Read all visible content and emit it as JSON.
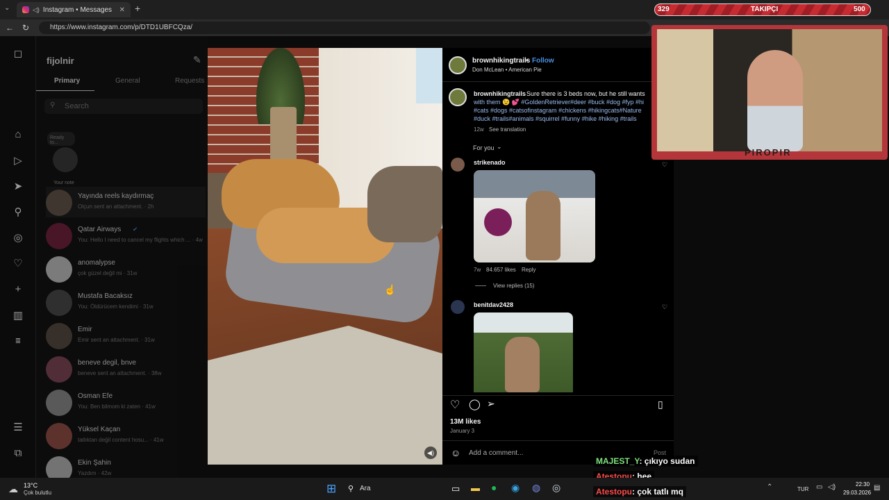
{
  "browser": {
    "tab_title": "Instagram • Messages",
    "url": "https://www.instagram.com/p/DTD1UBFCQza/"
  },
  "follower_bar": {
    "count_left": "329",
    "label": "TAKIPÇI",
    "count_right": "500"
  },
  "messages": {
    "username": "fijolnir",
    "tabs": [
      "Primary",
      "General",
      "Requests"
    ],
    "search_placeholder": "Search",
    "note_bubble": "Ready to...",
    "your_note": "Your note",
    "threads": [
      {
        "name": "Yayında reels kaydırmaç",
        "preview": "Olçun sent an attachment. · 2h"
      },
      {
        "name": "Qatar Airways",
        "preview": "You: Hello I need to cancel my flights which ... · 4w"
      },
      {
        "name": "anomalypse",
        "preview": "çok güzel değil mi · 31w"
      },
      {
        "name": "Mustafa Bacaksız",
        "preview": "You: Öldürücem kendimi · 31w"
      },
      {
        "name": "Emir",
        "preview": "Emir sent an attachment. · 31w"
      },
      {
        "name": "beneve degil, bnve",
        "preview": "beneve sent an attachment. · 38w"
      },
      {
        "name": "Osman Efe",
        "preview": "You: Ben bilmom ki zaten · 41w"
      },
      {
        "name": "Yüksel Kaçan",
        "preview": "tatlıktan değil content hosu... · 41w"
      },
      {
        "name": "Ekin Şahin",
        "preview": "Yazdım · 42w"
      }
    ]
  },
  "post": {
    "author": "brownhikingtrails",
    "follow": "Follow",
    "music": "Don McLean • American Pie",
    "caption_author": "brownhikingtrails",
    "caption_text": "Sure there is 3 beds now, but he still wants",
    "caption_line2": "with them 😉 💕 #GoldenRetriever#deer #buck #dog #fyp #hi",
    "caption_line3": "#cats #dogs #catsofinstagram #chickens #hikingcats#Nature",
    "caption_line4": "#duck #trails#animals #squirrel #funny #hike #hiking #trails",
    "caption_age": "12w",
    "see_translation": "See translation",
    "for_you": "For you",
    "comments": [
      {
        "user": "strikenado",
        "age": "7w",
        "likes": "84.657 likes",
        "reply": "Reply",
        "view_replies": "View replies (15)"
      },
      {
        "user": "benitdav2428"
      }
    ],
    "likes": "13M likes",
    "date": "January 3",
    "add_comment": "Add a comment...",
    "post_button": "Post"
  },
  "webcam": {
    "overlay_text": "PIROPIR"
  },
  "chat": [
    {
      "user": "MAJEST_Y",
      "msg": ": çıkıyo sudan",
      "color": "#7fe37f"
    },
    {
      "user": "Atestopu",
      "msg": ": hee",
      "color": "#ff4d4d"
    },
    {
      "user": "Atestopu",
      "msg": ": çok tatlı mq",
      "color": "#ff4d4d"
    }
  ],
  "taskbar": {
    "weather_temp": "13°C",
    "weather_desc": "Çok bulutlu",
    "search": "Ara",
    "lang": "TUR",
    "time": "22:30",
    "date": "29.03.2026"
  },
  "colors": {
    "accent": "#4a90e2",
    "instagram_bg": "#000000",
    "cam_frame": "#b5363a"
  }
}
